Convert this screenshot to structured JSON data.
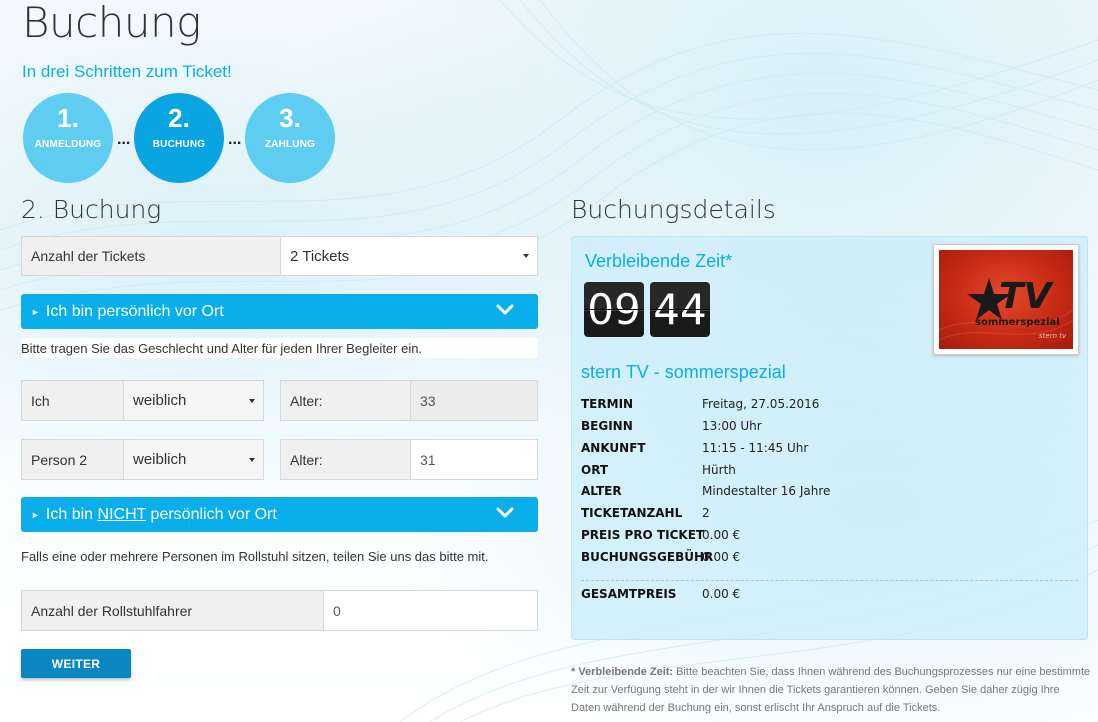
{
  "page": {
    "title": "Buchung",
    "subtitle": "In drei Schritten zum Ticket!"
  },
  "steps": [
    {
      "number": "1.",
      "label": "ANMELDUNG",
      "state": "inactive"
    },
    {
      "number": "2.",
      "label": "BUCHUNG",
      "state": "active"
    },
    {
      "number": "3.",
      "label": "ZAHLUNG",
      "state": "inactive"
    }
  ],
  "step_separator": "...",
  "form": {
    "heading": "2. Buchung",
    "tickets_label": "Anzahl der Tickets",
    "tickets_value": "2 Tickets",
    "accordion_present": {
      "text": "Ich bin persönlich vor Ort",
      "chevron_icon": "chevron-down-icon"
    },
    "hint_companions": "Bitte tragen Sie das Geschlecht und Alter für jeden Ihrer Begleiter ein.",
    "persons": [
      {
        "name": "Ich",
        "gender": "weiblich",
        "age_label": "Alter:",
        "age": "33",
        "readonly": true
      },
      {
        "name": "Person 2",
        "gender": "weiblich",
        "age_label": "Alter:",
        "age": "31",
        "readonly": false
      }
    ],
    "accordion_absent": {
      "text_before": "Ich bin ",
      "text_underlined": "NICHT",
      "text_after": " persönlich vor Ort",
      "chevron_icon": "chevron-down-icon"
    },
    "hint_wheelchair": "Falls eine oder mehrere Personen im Rollstuhl sitzen, teilen Sie uns das bitte mit.",
    "wheelchair_label": "Anzahl der Rollstuhlfahrer",
    "wheelchair_value": "0",
    "submit_label": "WEITER"
  },
  "details": {
    "heading": "Buchungsdetails",
    "timer_title": "Verbleibende Zeit*",
    "timer_minutes": "09",
    "timer_seconds": "44",
    "show_title": "stern TV - sommerspezial",
    "logo": {
      "main": "TV",
      "sub": "sommerspezial",
      "small": "stern tv"
    },
    "rows": [
      {
        "key": "TERMIN",
        "value": "Freitag, 27.05.2016"
      },
      {
        "key": "BEGINN",
        "value": "13:00 Uhr"
      },
      {
        "key": "ANKUNFT",
        "value": "11:15 - 11:45 Uhr"
      },
      {
        "key": "ORT",
        "value": "Hürth"
      },
      {
        "key": "ALTER",
        "value": "Mindestalter 16 Jahre"
      },
      {
        "key": "TICKETANZAHL",
        "value": "2"
      },
      {
        "key": "PREIS PRO TICKET",
        "value": "0.00 €"
      },
      {
        "key": "BUCHUNGSGEBÜHR",
        "value": "0.00 €"
      }
    ],
    "total": {
      "key": "GESAMTPREIS",
      "value": "0.00 €"
    }
  },
  "footnote": {
    "bold": "* Verbleibende Zeit:",
    "text": " Bitte beachten Sie, dass Ihnen während des Buchungsprozesses nur eine bestimmte Zeit zur Verfügung steht in der wir Ihnen die Tickets garantieren können. Geben Sie daher zügig Ihre Daten während der Buchung ein, sonst erlischt Ihr Anspruch auf die Tickets."
  },
  "colors": {
    "accent": "#0aaee8",
    "step_active": "#0aa4e3",
    "step_inactive": "#5fcdf2",
    "button": "#0a86c0",
    "details_bg": "#cdeefa"
  }
}
